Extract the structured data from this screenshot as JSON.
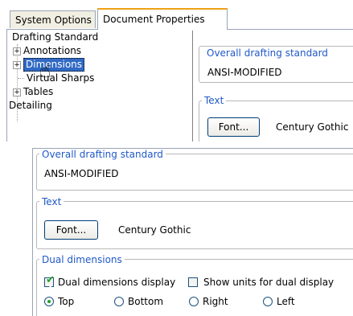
{
  "tabs": [
    {
      "label": "System Options"
    },
    {
      "label": "Document Properties"
    }
  ],
  "tree": {
    "items": [
      {
        "label": "Drafting Standard"
      },
      {
        "label": "Annotations"
      },
      {
        "label": "Dimensions"
      },
      {
        "label": "Virtual Sharps"
      },
      {
        "label": "Tables"
      },
      {
        "label": "Detailing"
      }
    ]
  },
  "overall": {
    "title": "Overall drafting standard",
    "value": "ANSI-MODIFIED"
  },
  "text_group": {
    "title": "Text",
    "font_button": "Font...",
    "font_value": "Century Gothic"
  },
  "dual": {
    "title": "Dual dimensions",
    "display_label": "Dual dimensions display",
    "display_checked": true,
    "units_label": "Show units for dual display",
    "units_checked": false,
    "positions": [
      {
        "label": "Top",
        "selected": true
      },
      {
        "label": "Bottom",
        "selected": false
      },
      {
        "label": "Right",
        "selected": false
      },
      {
        "label": "Left",
        "selected": false
      }
    ]
  },
  "colors": {
    "group_title": "#1f58c8",
    "selection": "#316ac5",
    "tab_highlight": "#f0a018",
    "check_green": "#21a121"
  }
}
